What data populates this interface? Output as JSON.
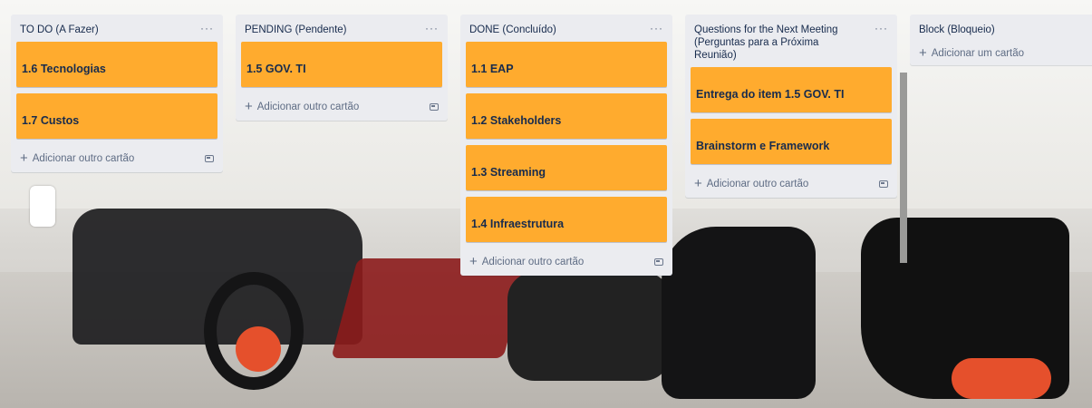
{
  "board": {
    "lists": [
      {
        "title": "TO DO (A Fazer)",
        "menu": "···",
        "cards": [
          "1.6 Tecnologias",
          "1.7 Custos"
        ],
        "add_label": "Adicionar outro cartão"
      },
      {
        "title": "PENDING (Pendente)",
        "menu": "···",
        "cards": [
          "1.5 GOV. TI"
        ],
        "add_label": "Adicionar outro cartão"
      },
      {
        "title": "DONE (Concluído)",
        "menu": "···",
        "cards": [
          "1.1 EAP",
          "1.2 Stakeholders",
          "1.3 Streaming",
          "1.4 Infraestrutura"
        ],
        "add_label": "Adicionar outro cartão"
      },
      {
        "title": "Questions for the Next Meeting (Perguntas para a Próxima Reunião)",
        "menu": "···",
        "cards": [
          "Entrega do item 1.5 GOV. TI",
          "Brainstorm e Framework"
        ],
        "add_label": "Adicionar outro cartão"
      },
      {
        "title": "Block (Bloqueio)",
        "menu": "",
        "cards": [],
        "add_label": "Adicionar um cartão"
      }
    ],
    "plus_symbol": "+",
    "card_color": "#ffab2e",
    "list_color": "#ebecf0",
    "template_icon": "card-template-icon"
  }
}
